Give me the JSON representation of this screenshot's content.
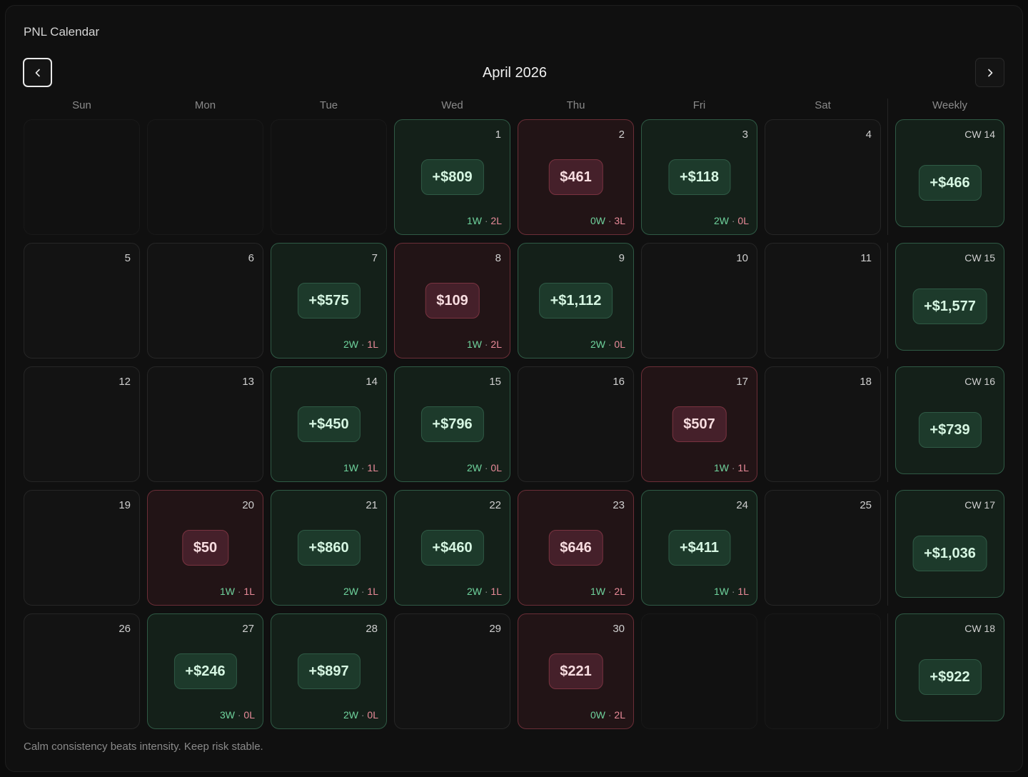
{
  "title": "PNL Calendar",
  "month_label": "April 2026",
  "nav": {
    "prev_icon": "chevron-left-icon",
    "next_icon": "chevron-right-icon"
  },
  "weekday_headers": [
    "Sun",
    "Mon",
    "Tue",
    "Wed",
    "Thu",
    "Fri",
    "Sat"
  ],
  "weekly_header": "Weekly",
  "colors": {
    "win": "#6fd39d",
    "loss": "#e88a98",
    "win_bg": "#142019",
    "loss_bg": "#221416"
  },
  "weeks": [
    {
      "days": [
        {
          "blank": true
        },
        {
          "blank": true
        },
        {
          "blank": true
        },
        {
          "day": "1",
          "pnl": "+$809",
          "status": "win",
          "w": "1W",
          "l": "2L"
        },
        {
          "day": "2",
          "pnl": "$461",
          "status": "loss",
          "w": "0W",
          "l": "3L"
        },
        {
          "day": "3",
          "pnl": "+$118",
          "status": "win",
          "w": "2W",
          "l": "0L"
        },
        {
          "day": "4",
          "status": "empty"
        }
      ],
      "weekly": {
        "label": "CW 14",
        "pnl": "+$466"
      }
    },
    {
      "days": [
        {
          "day": "5",
          "status": "empty"
        },
        {
          "day": "6",
          "status": "empty"
        },
        {
          "day": "7",
          "pnl": "+$575",
          "status": "win",
          "w": "2W",
          "l": "1L"
        },
        {
          "day": "8",
          "pnl": "$109",
          "status": "loss",
          "w": "1W",
          "l": "2L"
        },
        {
          "day": "9",
          "pnl": "+$1,112",
          "status": "win",
          "w": "2W",
          "l": "0L"
        },
        {
          "day": "10",
          "status": "empty"
        },
        {
          "day": "11",
          "status": "empty"
        }
      ],
      "weekly": {
        "label": "CW 15",
        "pnl": "+$1,577"
      }
    },
    {
      "days": [
        {
          "day": "12",
          "status": "empty"
        },
        {
          "day": "13",
          "status": "empty"
        },
        {
          "day": "14",
          "pnl": "+$450",
          "status": "win",
          "w": "1W",
          "l": "1L"
        },
        {
          "day": "15",
          "pnl": "+$796",
          "status": "win",
          "w": "2W",
          "l": "0L"
        },
        {
          "day": "16",
          "status": "empty"
        },
        {
          "day": "17",
          "pnl": "$507",
          "status": "loss",
          "w": "1W",
          "l": "1L"
        },
        {
          "day": "18",
          "status": "empty"
        }
      ],
      "weekly": {
        "label": "CW 16",
        "pnl": "+$739"
      }
    },
    {
      "days": [
        {
          "day": "19",
          "status": "empty"
        },
        {
          "day": "20",
          "pnl": "$50",
          "status": "loss",
          "w": "1W",
          "l": "1L"
        },
        {
          "day": "21",
          "pnl": "+$860",
          "status": "win",
          "w": "2W",
          "l": "1L"
        },
        {
          "day": "22",
          "pnl": "+$460",
          "status": "win",
          "w": "2W",
          "l": "1L"
        },
        {
          "day": "23",
          "pnl": "$646",
          "status": "loss",
          "w": "1W",
          "l": "2L"
        },
        {
          "day": "24",
          "pnl": "+$411",
          "status": "win",
          "w": "1W",
          "l": "1L"
        },
        {
          "day": "25",
          "status": "empty"
        }
      ],
      "weekly": {
        "label": "CW 17",
        "pnl": "+$1,036"
      }
    },
    {
      "days": [
        {
          "day": "26",
          "status": "empty"
        },
        {
          "day": "27",
          "pnl": "+$246",
          "status": "win",
          "w": "3W",
          "l": "0L"
        },
        {
          "day": "28",
          "pnl": "+$897",
          "status": "win",
          "w": "2W",
          "l": "0L"
        },
        {
          "day": "29",
          "status": "empty"
        },
        {
          "day": "30",
          "pnl": "$221",
          "status": "loss",
          "w": "0W",
          "l": "2L"
        },
        {
          "blank": true
        },
        {
          "blank": true
        }
      ],
      "weekly": {
        "label": "CW 18",
        "pnl": "+$922"
      }
    }
  ],
  "footer_text": "Calm consistency beats intensity. Keep risk stable."
}
